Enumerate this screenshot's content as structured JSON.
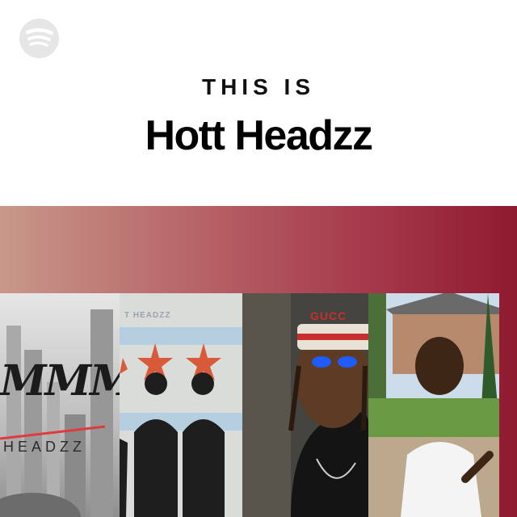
{
  "header": {
    "eyebrow": "THIS IS",
    "title": "Hott Headzz"
  },
  "brand": {
    "logo_icon": "spotify-logo-icon",
    "logo_color": "#e8e8e8"
  },
  "banner": {
    "gradient": [
      "#c8988a",
      "#a63a4c",
      "#8f1a30"
    ]
  },
  "tiles": [
    {
      "sig": "MMM",
      "sub": "HEADZZ"
    },
    {
      "caption": "T HEADZZ"
    },
    {
      "cap_text": "GUCC"
    },
    {}
  ]
}
